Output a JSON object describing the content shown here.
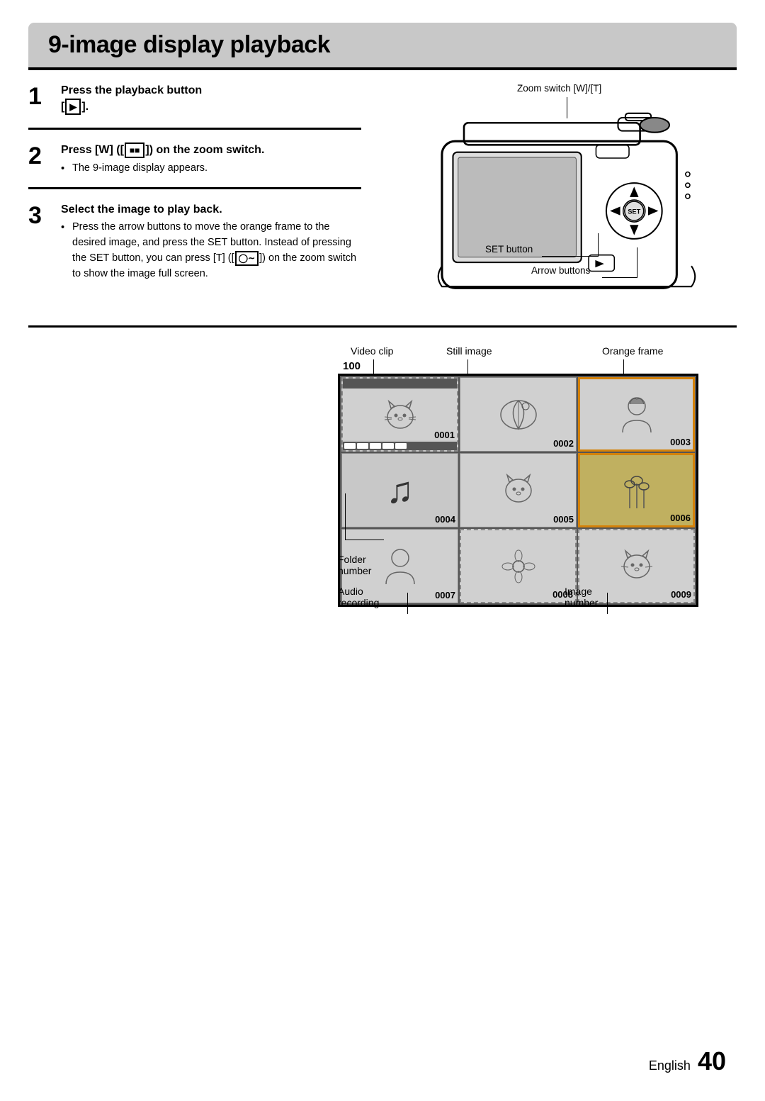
{
  "page": {
    "title": "9-image display playback",
    "footer": {
      "language": "English",
      "page_number": "40"
    }
  },
  "steps": [
    {
      "number": "1",
      "title": "Press the playback button\n[►].",
      "title_parts": [
        "Press the playback button",
        "[►]."
      ],
      "body": null
    },
    {
      "number": "2",
      "title_parts": [
        "Press [W] ([",
        "]]) on the zoom switch."
      ],
      "has_icon": true,
      "icon_text": "⊠⊠",
      "bullets": [
        "The 9-image display appears."
      ]
    },
    {
      "number": "3",
      "title_parts": [
        "Select the image to play back."
      ],
      "bullets": [
        "Press the arrow buttons to move the orange frame to the desired image, and press the SET button. Instead of pressing the SET button, you can press [T] ([○∼]) on the zoom switch to show the image full screen."
      ]
    }
  ],
  "camera_labels": {
    "zoom_switch": "Zoom switch [W]/[T]",
    "set_button": "SET button",
    "arrow_buttons": "Arrow buttons"
  },
  "grid_labels": {
    "video_clip": "Video clip",
    "still_image": "Still image",
    "orange_frame": "Orange frame",
    "audio_recording": "Audio recording",
    "image_number": "Image number",
    "folder_number": "Folder number",
    "folder_num_value": "100"
  },
  "grid_cells": [
    {
      "number": "0001",
      "type": "video",
      "dashed": true,
      "selected": false
    },
    {
      "number": "0002",
      "type": "still",
      "dashed": false,
      "selected": false
    },
    {
      "number": "0003",
      "type": "still",
      "dashed": false,
      "selected": false
    },
    {
      "number": "0004",
      "type": "audio",
      "dashed": false,
      "selected": false
    },
    {
      "number": "0005",
      "type": "still",
      "dashed": false,
      "selected": false
    },
    {
      "number": "0006",
      "type": "still",
      "dashed": false,
      "selected": true
    },
    {
      "number": "0007",
      "type": "still",
      "dashed": false,
      "selected": false
    },
    {
      "number": "0008",
      "type": "still",
      "dashed": true,
      "selected": false
    },
    {
      "number": "0009",
      "type": "still",
      "dashed": true,
      "selected": false
    }
  ]
}
